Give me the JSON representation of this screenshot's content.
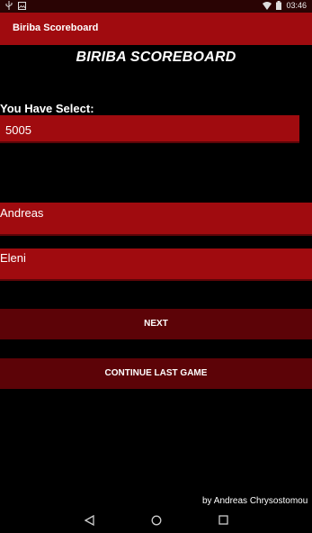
{
  "status_bar": {
    "time": "03:46",
    "left_icons": [
      "usb-icon",
      "image-notification-icon"
    ],
    "right_icons": [
      "wifi-icon",
      "battery-icon"
    ]
  },
  "app_bar": {
    "title": "Biriba Scoreboard"
  },
  "main": {
    "heading": "BIRIBA SCOREBOARD",
    "select_label": "You Have Select:",
    "selected_value": "5005",
    "player1": "Andreas",
    "player2": "Eleni",
    "next_label": "NEXT",
    "continue_label": "CONTINUE LAST GAME",
    "credit": "by Andreas Chrysostomou"
  },
  "nav_bar": {
    "icons": [
      "back-icon",
      "home-icon",
      "recents-icon"
    ]
  },
  "colors": {
    "accent": "#a00b0f",
    "button": "#5c0307",
    "background": "#000000"
  }
}
